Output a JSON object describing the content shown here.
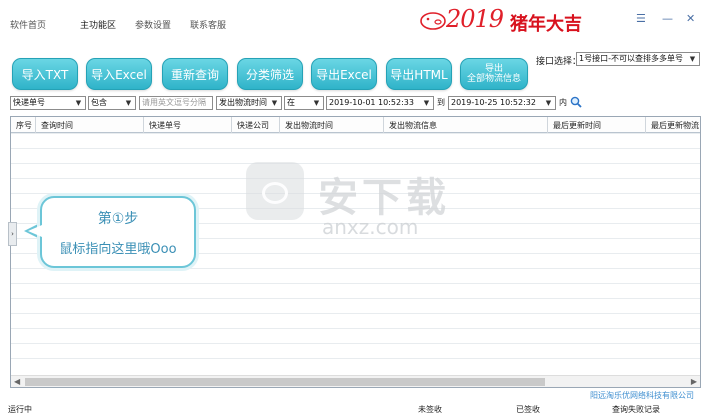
{
  "nav": {
    "items": [
      "软件首页",
      "主功能区",
      "参数设置",
      "联系客服"
    ],
    "active_index": 1
  },
  "brand": {
    "script_text": "2019",
    "cn_text": "猪年大吉",
    "color": "#e0202a"
  },
  "window_controls": {
    "menu": "☰",
    "minimize": "—",
    "close": "✕"
  },
  "toolbar": {
    "buttons": [
      "导入TXT",
      "导入Excel",
      "重新查询",
      "分类筛选",
      "导出Excel",
      "导出HTML"
    ],
    "export_all_line1": "导出",
    "export_all_line2": "全部物流信息",
    "accent": "#2fb3c9"
  },
  "interface": {
    "label": "接口选择：",
    "selected": "1号接口-不可以查排多多单号"
  },
  "filter": {
    "field": "快递单号",
    "op": "包含",
    "input_placeholder": "请用英文逗号分隔",
    "time_field": "发出物流时间",
    "time_op": "在",
    "start": "2019-10-01 10:52:33",
    "to_label": "到",
    "end": "2019-10-25 10:52:32",
    "within_label": "内"
  },
  "grid": {
    "columns": [
      "序号",
      "查询时间",
      "快递单号",
      "快递公司",
      "发出物流时间",
      "发出物流信息",
      "最后更新时间",
      "最后更新物流"
    ]
  },
  "callout": {
    "step": "第①步",
    "text": "鼠标指向这里哦Ooo"
  },
  "side_handle": "›",
  "watermark": {
    "cn": "安下载",
    "en": "anxz.com"
  },
  "footer": {
    "company": "阳远淘乐优网络科技有限公司",
    "running": "运行中",
    "unsigned": "未签收",
    "signed": "已签收",
    "failed": "查询失败记录"
  }
}
